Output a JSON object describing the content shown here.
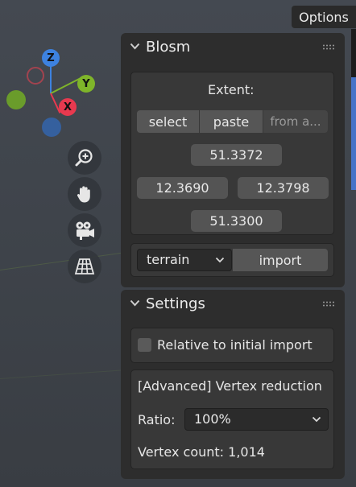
{
  "options": {
    "label": "Options"
  },
  "gizmo": {
    "z": "Z",
    "y": "Y",
    "x": "X"
  },
  "nav_tools": [
    "zoom-icon",
    "hand-pan-icon",
    "camera-icon",
    "ortho-grid-icon"
  ],
  "blosm_panel": {
    "title": "Blosm",
    "extent_label": "Extent:",
    "select_label": "select",
    "paste_label": "paste",
    "from_label": "from a...",
    "north": "51.3372",
    "west": "12.3690",
    "east": "12.3798",
    "south": "51.3300",
    "data_type": "terrain",
    "import_label": "import"
  },
  "settings_panel": {
    "title": "Settings",
    "relative_label": "Relative to initial import",
    "relative_checked": false,
    "vertex_reduction_label": "[Advanced] Vertex reduction",
    "ratio_label": "Ratio:",
    "ratio_value": "100%",
    "vertex_count_label": "Vertex count: 1,014"
  },
  "colors": {
    "panel_bg": "#2d2d2d",
    "subbox_bg": "#383838",
    "button_bg": "#565656",
    "axis_x": "#e8394f",
    "axis_y": "#7fb52a",
    "axis_z": "#3d82e0",
    "accent_blue": "#4673c8"
  }
}
